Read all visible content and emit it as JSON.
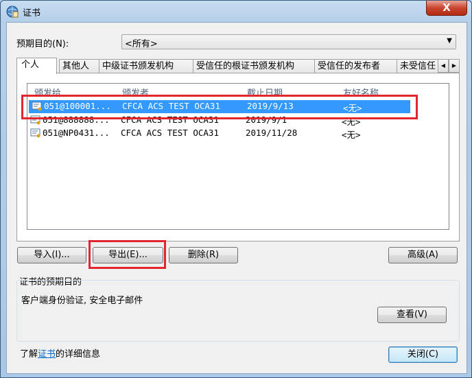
{
  "window": {
    "title": "证书",
    "close_symbol": "X"
  },
  "purpose_label": "预期目的(N):",
  "purpose_combo": {
    "value": "<所有>"
  },
  "tabs": [
    {
      "label": "个人",
      "active": true
    },
    {
      "label": "其他人"
    },
    {
      "label": "中级证书颁发机构"
    },
    {
      "label": "受信任的根证书颁发机构"
    },
    {
      "label": "受信任的发布者"
    },
    {
      "label": "未受信任"
    }
  ],
  "columns": [
    "颁发给",
    "颁发者",
    "截止日期",
    "友好名称"
  ],
  "rows": [
    {
      "issued_to": "051@100001...",
      "issuer": "CFCA ACS TEST OCA31",
      "expires": "2019/9/13",
      "friendly": "<无>",
      "selected": true
    },
    {
      "issued_to": "051@888888...",
      "issuer": "CFCA ACS TEST OCA31",
      "expires": "2019/9/1",
      "friendly": "<无>"
    },
    {
      "issued_to": "051@NP0431...",
      "issuer": "CFCA ACS TEST OCA31",
      "expires": "2019/11/28",
      "friendly": "<无>"
    }
  ],
  "buttons": {
    "import": "导入(I)...",
    "export": "导出(E)...",
    "remove": "删除(R)",
    "advanced": "高级(A)",
    "view": "查看(V)",
    "close": "关闭(C)"
  },
  "group": {
    "title": "证书的预期目的",
    "text": "客户端身份验证, 安全电子邮件"
  },
  "footer": {
    "prefix": "了解",
    "link": "证书",
    "suffix": "的详细信息"
  },
  "colors": {
    "selection": "#3399ff",
    "highlight_box": "#e3262e",
    "link": "#0066cc"
  }
}
